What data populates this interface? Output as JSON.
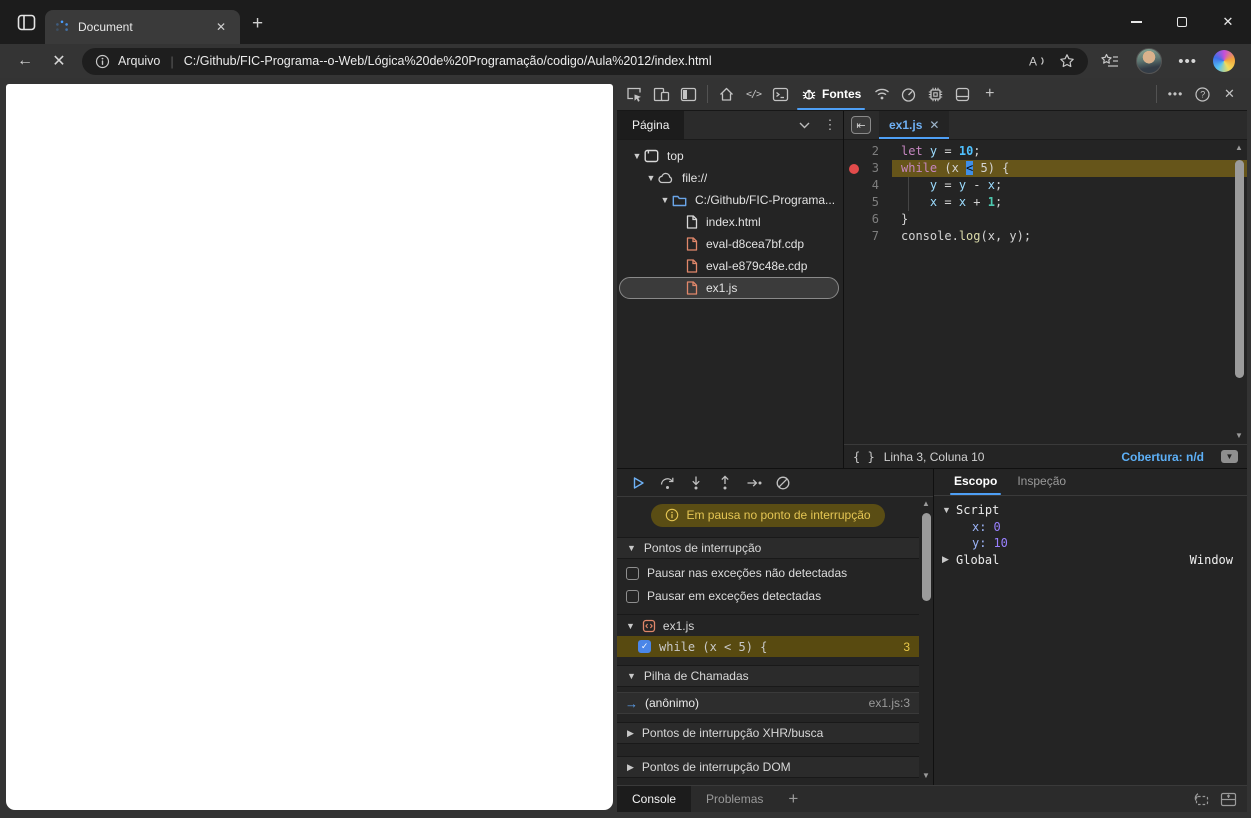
{
  "palette": {
    "accent_blue": "#4e9ff5",
    "devtools_bg": "#242424",
    "titlebar_bg": "#1c1c1c",
    "paused_banner_bg": "#5a4d14",
    "paused_banner_fg": "#e5c654",
    "exec_line_highlight": "#66551a",
    "breakpoint_red": "#e24b4b",
    "orange_file": "#e0876a",
    "code_keyword": "#c586c0",
    "code_variable": "#9cdcfe",
    "code_number": "#4fc1ff",
    "code_number_alt": "#4ec9b0",
    "code_function": "#dcdcaa",
    "scope_name": "#9cb4f8",
    "scope_value": "#9980ff"
  },
  "browser": {
    "tab_title": "Document",
    "toolbar": {
      "info_label": "Arquivo",
      "url": "C:/Github/FIC-Programa--o-Web/Lógica%20de%20Programação/codigo/Aula%2012/index.html",
      "icons": [
        "back-icon",
        "stop-icon",
        "info-icon",
        "read-aloud-icon",
        "favorite-star-icon",
        "favorites-bar-icon",
        "profile-avatar",
        "settings-ellipsis-icon",
        "copilot-icon"
      ]
    },
    "window_controls": [
      "minimize",
      "maximize",
      "close"
    ]
  },
  "devtools": {
    "toolbar": {
      "sources_tab_label": "Fontes",
      "icons": [
        "inspect-icon",
        "device-emulation-icon",
        "dock-side-icon",
        "home-icon",
        "elements-icon",
        "console-panel-icon",
        "sources-bug-icon",
        "network-icon",
        "performance-icon",
        "memory-icon",
        "application-icon",
        "add-tools-icon",
        "more-options-icon",
        "help-icon",
        "close-devtools-icon"
      ]
    },
    "navigator": {
      "tab_label": "Página",
      "tree": [
        {
          "label": "top",
          "icon": "frame",
          "depth": 0,
          "expanded": true
        },
        {
          "label": "file://",
          "icon": "cloud",
          "depth": 1,
          "expanded": true
        },
        {
          "label": "C:/Github/FIC-Programa...",
          "icon": "folder",
          "depth": 2,
          "expanded": true
        },
        {
          "label": "index.html",
          "icon": "file",
          "file_color": "#d8d8d8",
          "depth": 3
        },
        {
          "label": "eval-d8cea7bf.cdp",
          "icon": "file",
          "file_color": "#e0876a",
          "depth": 3
        },
        {
          "label": "eval-e879c48e.cdp",
          "icon": "file",
          "file_color": "#e0876a",
          "depth": 3
        },
        {
          "label": "ex1.js",
          "icon": "file",
          "file_color": "#e0876a",
          "depth": 3,
          "selected": true
        }
      ]
    },
    "editor": {
      "tab_label": "ex1.js",
      "status_position": "Linha 3, Coluna 10",
      "status_coverage": "Cobertura: n/d",
      "lines": [
        {
          "num": "2",
          "tokens": [
            {
              "t": "let",
              "c": "kw"
            },
            {
              "t": " ",
              "c": "tx"
            },
            {
              "t": "y",
              "c": "var"
            },
            {
              "t": " = ",
              "c": "tx"
            },
            {
              "t": "10",
              "c": "num"
            },
            {
              "t": ";",
              "c": "tx"
            }
          ]
        },
        {
          "num": "3",
          "highlight": true,
          "breakpoint": true,
          "tokens": [
            {
              "t": "while",
              "c": "kw"
            },
            {
              "t": " (x ",
              "c": "tx"
            },
            {
              "t": "<",
              "c": "pos"
            },
            {
              "t": " 5) {",
              "c": "tx"
            }
          ]
        },
        {
          "num": "4",
          "guide": true,
          "tokens": [
            {
              "t": "    ",
              "c": "tx"
            },
            {
              "t": "y",
              "c": "var"
            },
            {
              "t": " = ",
              "c": "tx"
            },
            {
              "t": "y",
              "c": "var"
            },
            {
              "t": " - ",
              "c": "tx"
            },
            {
              "t": "x",
              "c": "var"
            },
            {
              "t": ";",
              "c": "tx"
            }
          ]
        },
        {
          "num": "5",
          "guide": true,
          "tokens": [
            {
              "t": "    ",
              "c": "tx"
            },
            {
              "t": "x",
              "c": "var"
            },
            {
              "t": " = ",
              "c": "tx"
            },
            {
              "t": "x",
              "c": "var"
            },
            {
              "t": " + ",
              "c": "tx"
            },
            {
              "t": "1",
              "c": "num2"
            },
            {
              "t": ";",
              "c": "tx"
            }
          ]
        },
        {
          "num": "6",
          "tokens": [
            {
              "t": "}",
              "c": "tx"
            }
          ]
        },
        {
          "num": "7",
          "tokens": [
            {
              "t": "console",
              "c": "tx"
            },
            {
              "t": ".",
              "c": "tx"
            },
            {
              "t": "log",
              "c": "fn"
            },
            {
              "t": "(x, y);",
              "c": "tx"
            }
          ]
        }
      ]
    },
    "debugger": {
      "paused_message": "Em pausa no ponto de interrupção",
      "sections": {
        "breakpoints": "Pontos de interrupção",
        "callstack": "Pilha de Chamadas",
        "xhr": "Pontos de interrupção XHR/busca",
        "dom": "Pontos de interrupção DOM"
      },
      "exception_options": [
        "Pausar nas exceções não detectadas",
        "Pausar em exceções detectadas"
      ],
      "breakpoint_group": "ex1.js",
      "breakpoint_code": "while (x < 5) {",
      "breakpoint_line": "3",
      "frame_name": "(anônimo)",
      "frame_location": "ex1.js:3",
      "control_icons": [
        "resume-icon",
        "step-over-icon",
        "step-into-icon",
        "step-out-icon",
        "step-icon",
        "deactivate-breakpoints-icon"
      ]
    },
    "scope": {
      "tabs": [
        "Escopo",
        "Inspeção"
      ],
      "active_tab": "Escopo",
      "script_label": "Script",
      "vars": [
        {
          "name": "x:",
          "value": "0"
        },
        {
          "name": "y:",
          "value": "10"
        }
      ],
      "global_label": "Global",
      "global_value": "Window"
    },
    "drawer": {
      "tabs": [
        "Console",
        "Problemas"
      ],
      "add_label": "+"
    }
  }
}
